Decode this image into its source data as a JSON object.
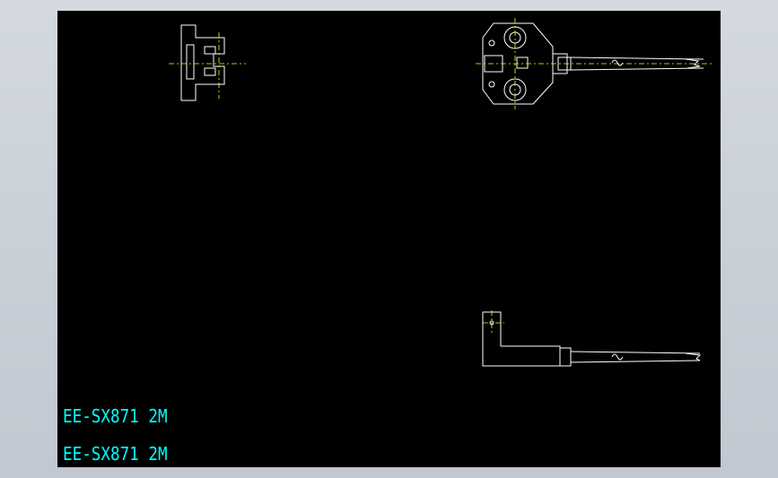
{
  "drawing": {
    "background": "#000000",
    "line_color": "#ffffff",
    "centerline_color": "#ffff00",
    "text_color": "#00ffff",
    "labels": [
      "EE-SX871 2M",
      "EE-SX871 2M"
    ]
  }
}
